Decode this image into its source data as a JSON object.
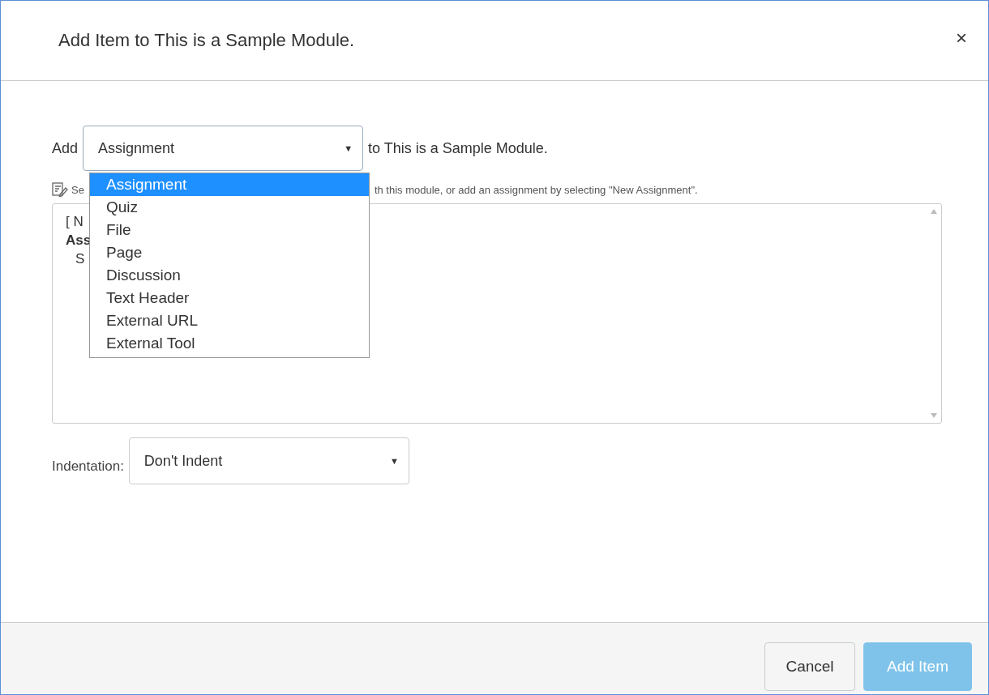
{
  "dialog": {
    "title": "Add Item to This is a Sample Module.",
    "close": "×"
  },
  "add_row": {
    "label": "Add",
    "select_value": "Assignment",
    "caret": "▼",
    "suffix": "to This is a Sample Module."
  },
  "dropdown": {
    "options": [
      {
        "label": "Assignment",
        "selected": true
      },
      {
        "label": "Quiz",
        "selected": false
      },
      {
        "label": "File",
        "selected": false
      },
      {
        "label": "Page",
        "selected": false
      },
      {
        "label": "Discussion",
        "selected": false
      },
      {
        "label": "Text Header",
        "selected": false
      },
      {
        "label": "External URL",
        "selected": false
      },
      {
        "label": "External Tool",
        "selected": false
      }
    ]
  },
  "hint": {
    "start": "Se",
    "end": "th this module, or add an assignment by selecting \"New Assignment\"."
  },
  "listbox": {
    "lines": [
      {
        "text": "[ N",
        "kind": "plain"
      },
      {
        "text": "Ass",
        "kind": "group"
      },
      {
        "text": "S",
        "kind": "child"
      }
    ]
  },
  "indentation": {
    "label": "Indentation:",
    "value": "Don't Indent",
    "caret": "▼"
  },
  "buttons": [
    {
      "label": "Cancel",
      "kind": "secondary"
    },
    {
      "label": "Add Item",
      "kind": "primary"
    }
  ]
}
